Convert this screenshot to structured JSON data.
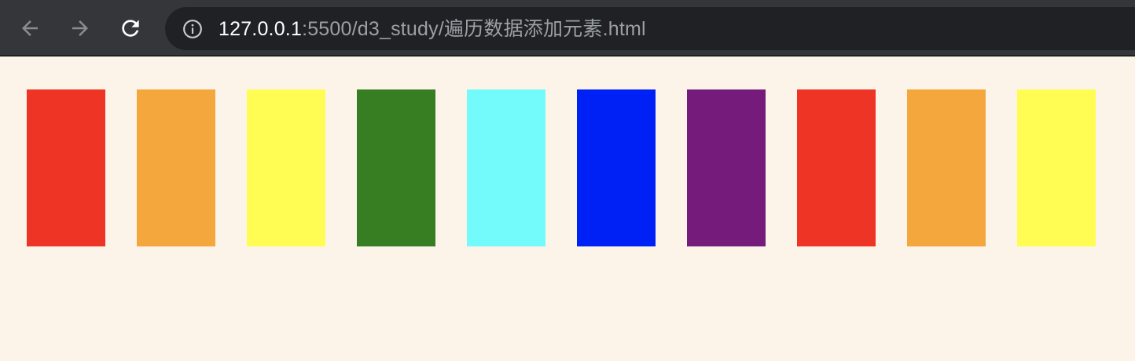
{
  "browser": {
    "url_host": "127.0.0.1",
    "url_path": ":5500/d3_study/遍历数据添加元素.html",
    "toolbar_color": "#35363a",
    "omnibox_color": "#202124",
    "icons": [
      "back-arrow-icon",
      "forward-arrow-icon",
      "reload-icon",
      "info-icon"
    ]
  },
  "page": {
    "background": "#fcf4e8",
    "rects": [
      {
        "color": "#ee3424"
      },
      {
        "color": "#f3a73c"
      },
      {
        "color": "#fffd54"
      },
      {
        "color": "#377e22"
      },
      {
        "color": "#73fbfb"
      },
      {
        "color": "#0021f5"
      },
      {
        "color": "#751b7b"
      },
      {
        "color": "#ee3424"
      },
      {
        "color": "#f3a73c"
      },
      {
        "color": "#fffd54"
      }
    ]
  }
}
